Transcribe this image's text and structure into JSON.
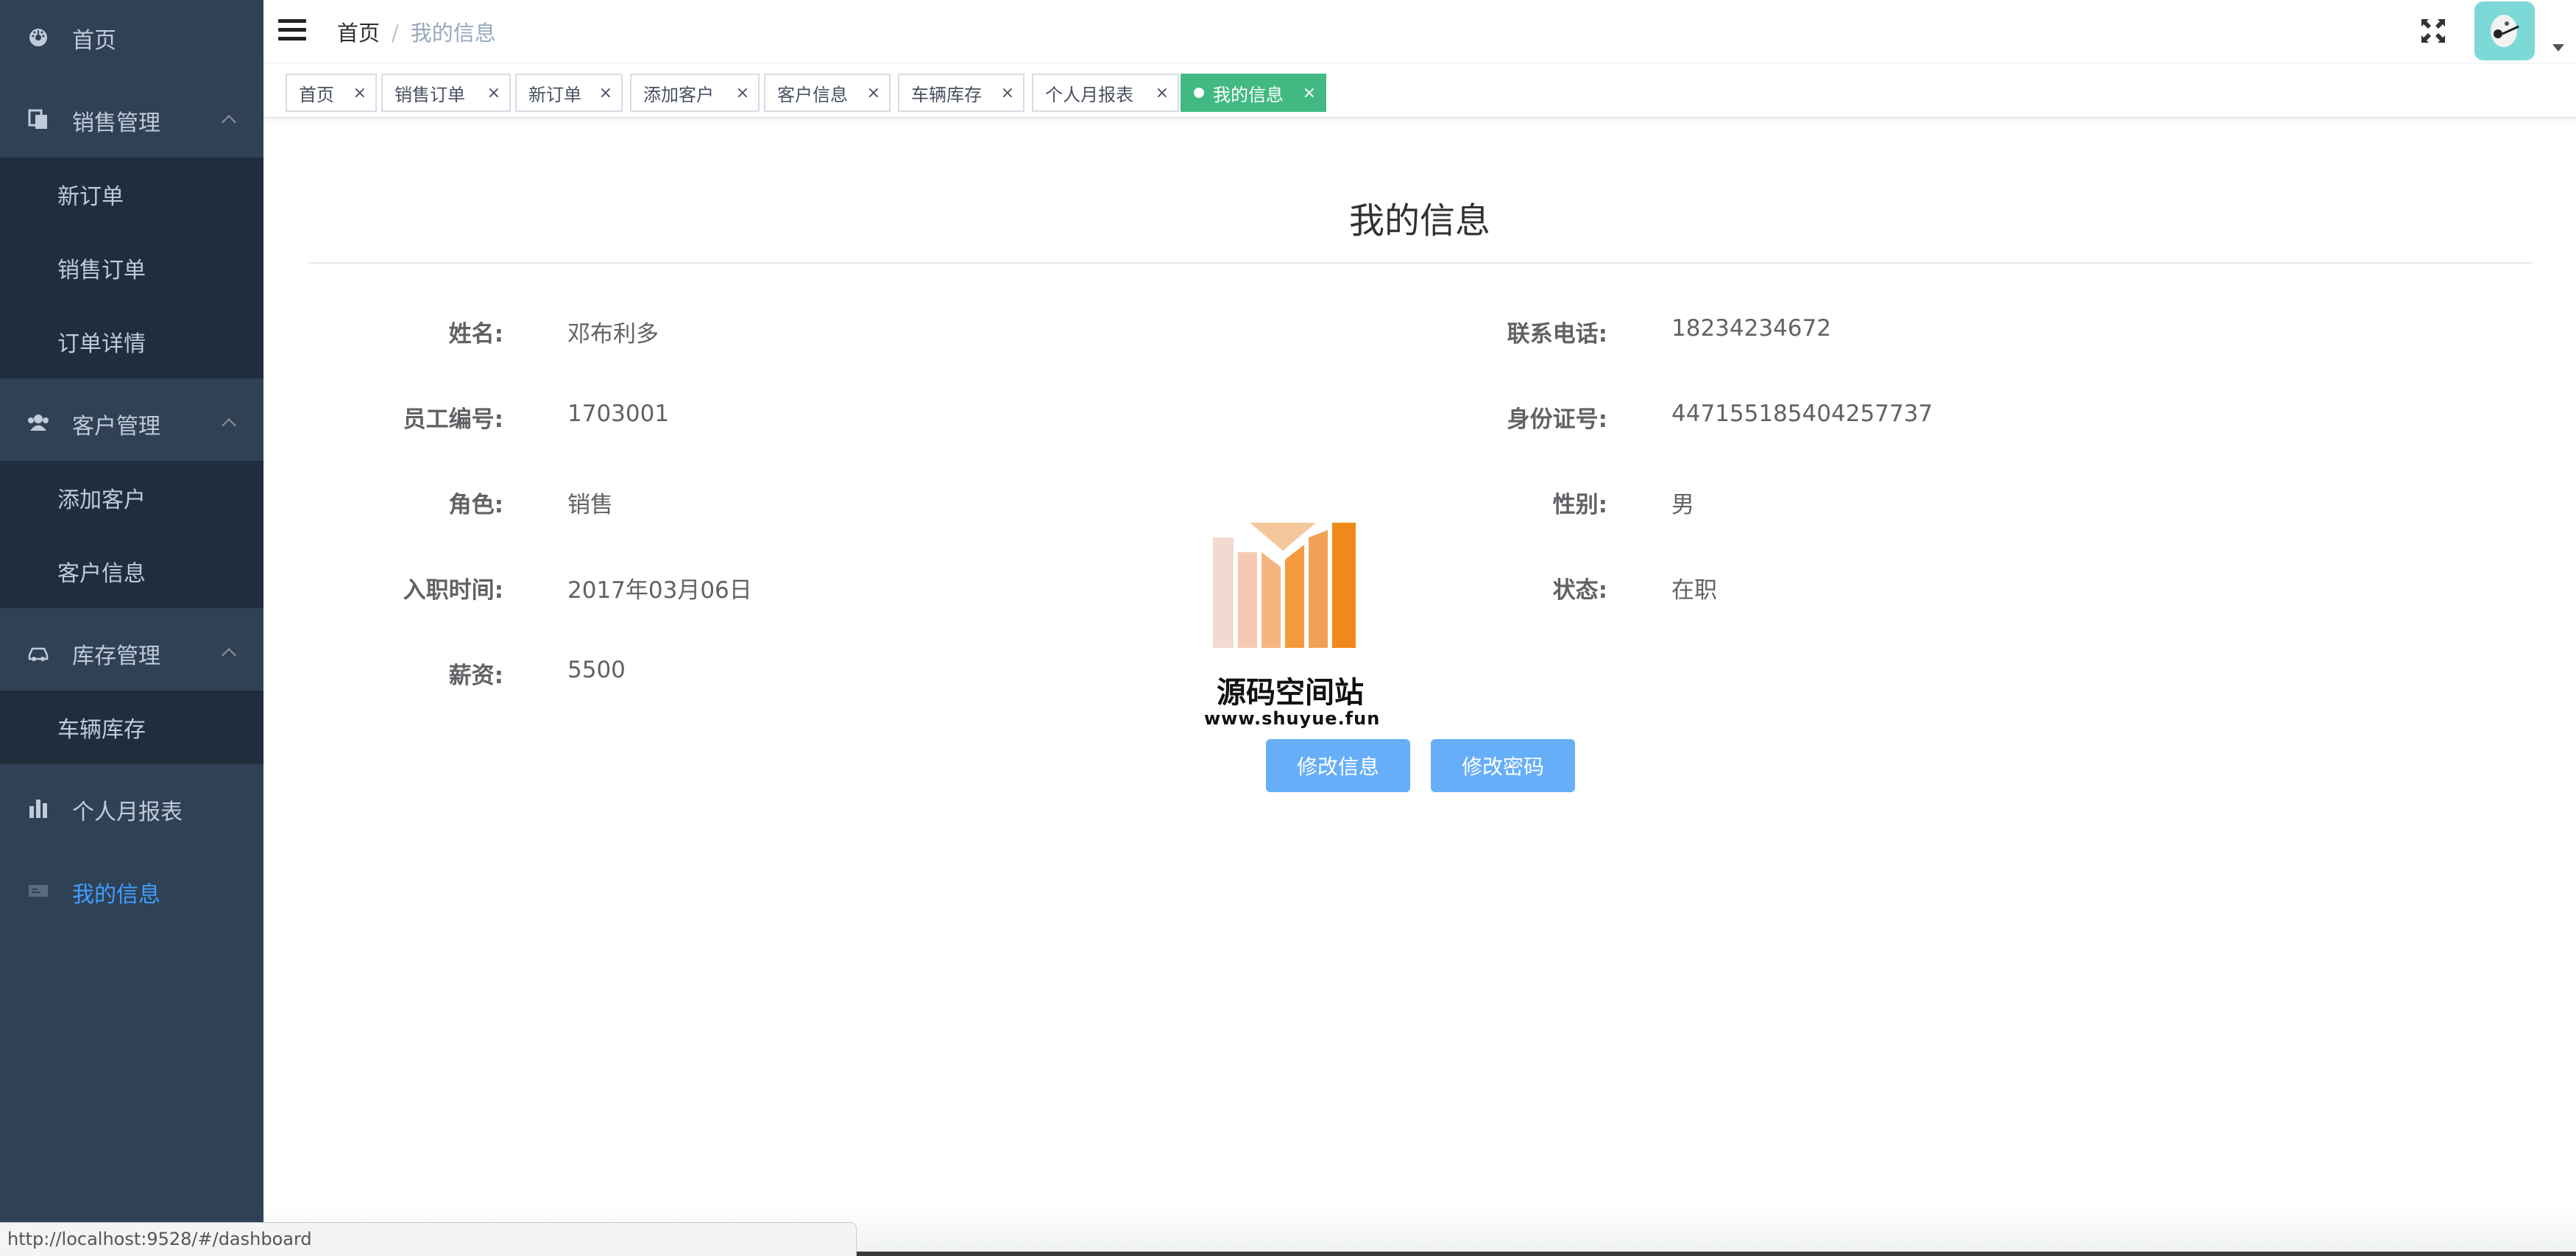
{
  "sidebar": {
    "home": {
      "label": "首页",
      "icon": "dashboard-icon"
    },
    "sales": {
      "label": "销售管理",
      "icon": "documents-icon",
      "children": [
        {
          "label": "新订单"
        },
        {
          "label": "销售订单"
        },
        {
          "label": "订单详情"
        }
      ]
    },
    "customers": {
      "label": "客户管理",
      "icon": "people-icon",
      "children": [
        {
          "label": "添加客户"
        },
        {
          "label": "客户信息"
        }
      ]
    },
    "inventory": {
      "label": "库存管理",
      "icon": "car-icon",
      "children": [
        {
          "label": "车辆库存"
        }
      ]
    },
    "report": {
      "label": "个人月报表",
      "icon": "bar-chart-icon"
    },
    "myinfo": {
      "label": "我的信息",
      "icon": "id-card-icon"
    },
    "active_color": "#409eff"
  },
  "navbar": {
    "breadcrumb": {
      "home": "首页",
      "separator": "/",
      "current": "我的信息"
    }
  },
  "tags": [
    {
      "label": "首页"
    },
    {
      "label": "销售订单"
    },
    {
      "label": "新订单"
    },
    {
      "label": "添加客户"
    },
    {
      "label": "客户信息"
    },
    {
      "label": "车辆库存"
    },
    {
      "label": "个人月报表"
    },
    {
      "label": "我的信息",
      "active": true
    }
  ],
  "tag_close": "×",
  "main": {
    "title": "我的信息",
    "fields": {
      "name": {
        "label": "姓名:",
        "value": "邓布利多"
      },
      "phone": {
        "label": "联系电话:",
        "value": "18234234672"
      },
      "emp_no": {
        "label": "员工编号:",
        "value": "1703001"
      },
      "id_no": {
        "label": "身份证号:",
        "value": "447155185404257737"
      },
      "role": {
        "label": "角色:",
        "value": "销售"
      },
      "gender": {
        "label": "性别:",
        "value": "男"
      },
      "hire_date": {
        "label": "入职时间:",
        "value": "2017年03月06日"
      },
      "status": {
        "label": "状态:",
        "value": "在职"
      },
      "salary": {
        "label": "薪资:",
        "value": "5500"
      }
    },
    "buttons": {
      "edit_info": "修改信息",
      "edit_password": "修改密码"
    }
  },
  "watermark": {
    "name": "源码空间站",
    "url": "www.shuyue.fun"
  },
  "status_url": "http://localhost:9528/#/dashboard",
  "colors": {
    "sidebar_bg": "#304156",
    "submenu_bg": "#1f2d3d",
    "tag_active": "#42b983",
    "button": "#66aef7"
  }
}
